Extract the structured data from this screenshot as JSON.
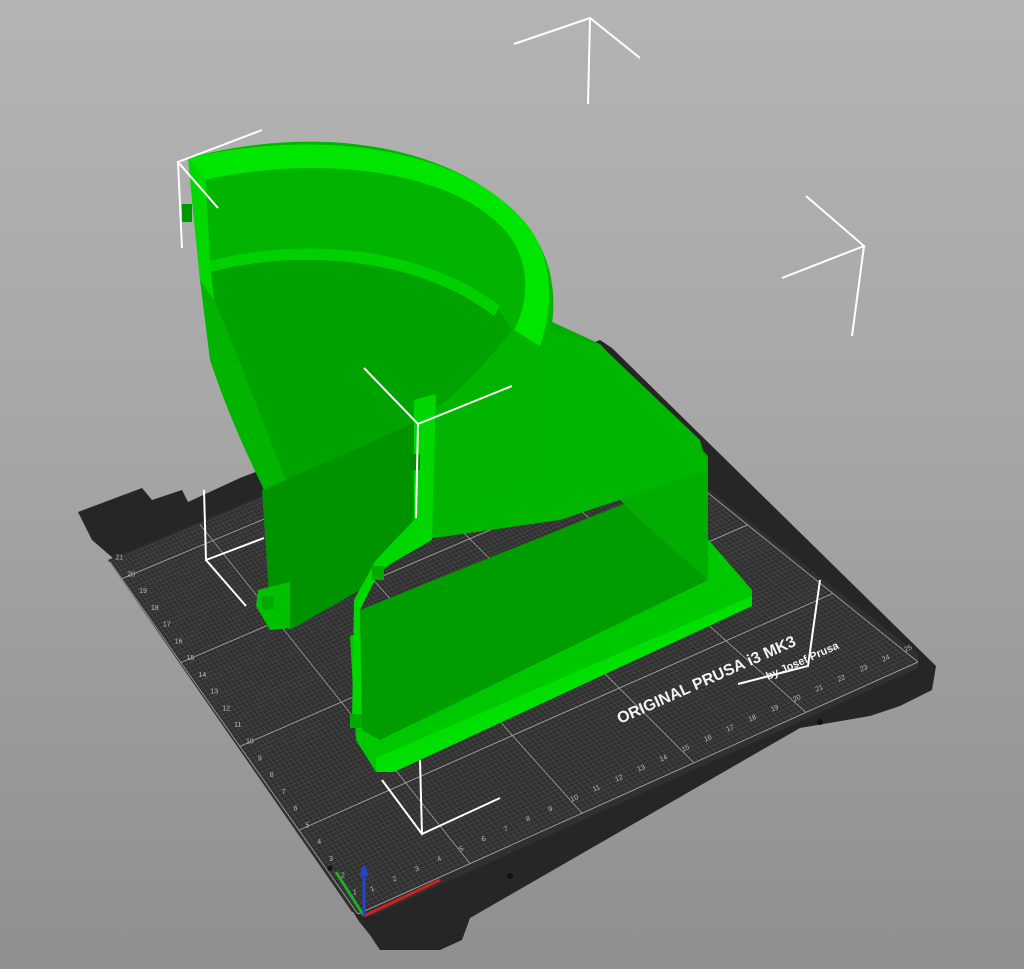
{
  "viewport": {
    "background_top": "#b4b4b4",
    "background_bottom": "#8f8f8f"
  },
  "bed": {
    "brand_text": "ORIGINAL PRUSA i3  MK3",
    "subtitle_text": "by Josef Prusa",
    "x_ticks": [
      "1",
      "2",
      "3",
      "4",
      "5",
      "6",
      "7",
      "8",
      "9",
      "10",
      "11",
      "12",
      "13",
      "14",
      "15",
      "16",
      "17",
      "18",
      "19",
      "20",
      "21",
      "22",
      "23",
      "24",
      "25"
    ],
    "y_ticks": [
      "1",
      "2",
      "3",
      "4",
      "5",
      "6",
      "7",
      "8",
      "9",
      "10",
      "11",
      "12",
      "13",
      "14",
      "15",
      "16",
      "17",
      "18",
      "19",
      "20",
      "21"
    ],
    "color_sheet": "#2d2d2d",
    "color_frame": "#1e1e1e",
    "color_grid": "#8a8a8a"
  },
  "model": {
    "name_icon": "printed-part-model",
    "color_light": "#00d400",
    "color_mid": "#00b000",
    "color_dark": "#008f00"
  },
  "axes": {
    "x_color": "#cc2222",
    "y_color": "#22aa22",
    "z_color": "#2244cc"
  },
  "selection": {
    "corner_color": "#ffffff"
  }
}
